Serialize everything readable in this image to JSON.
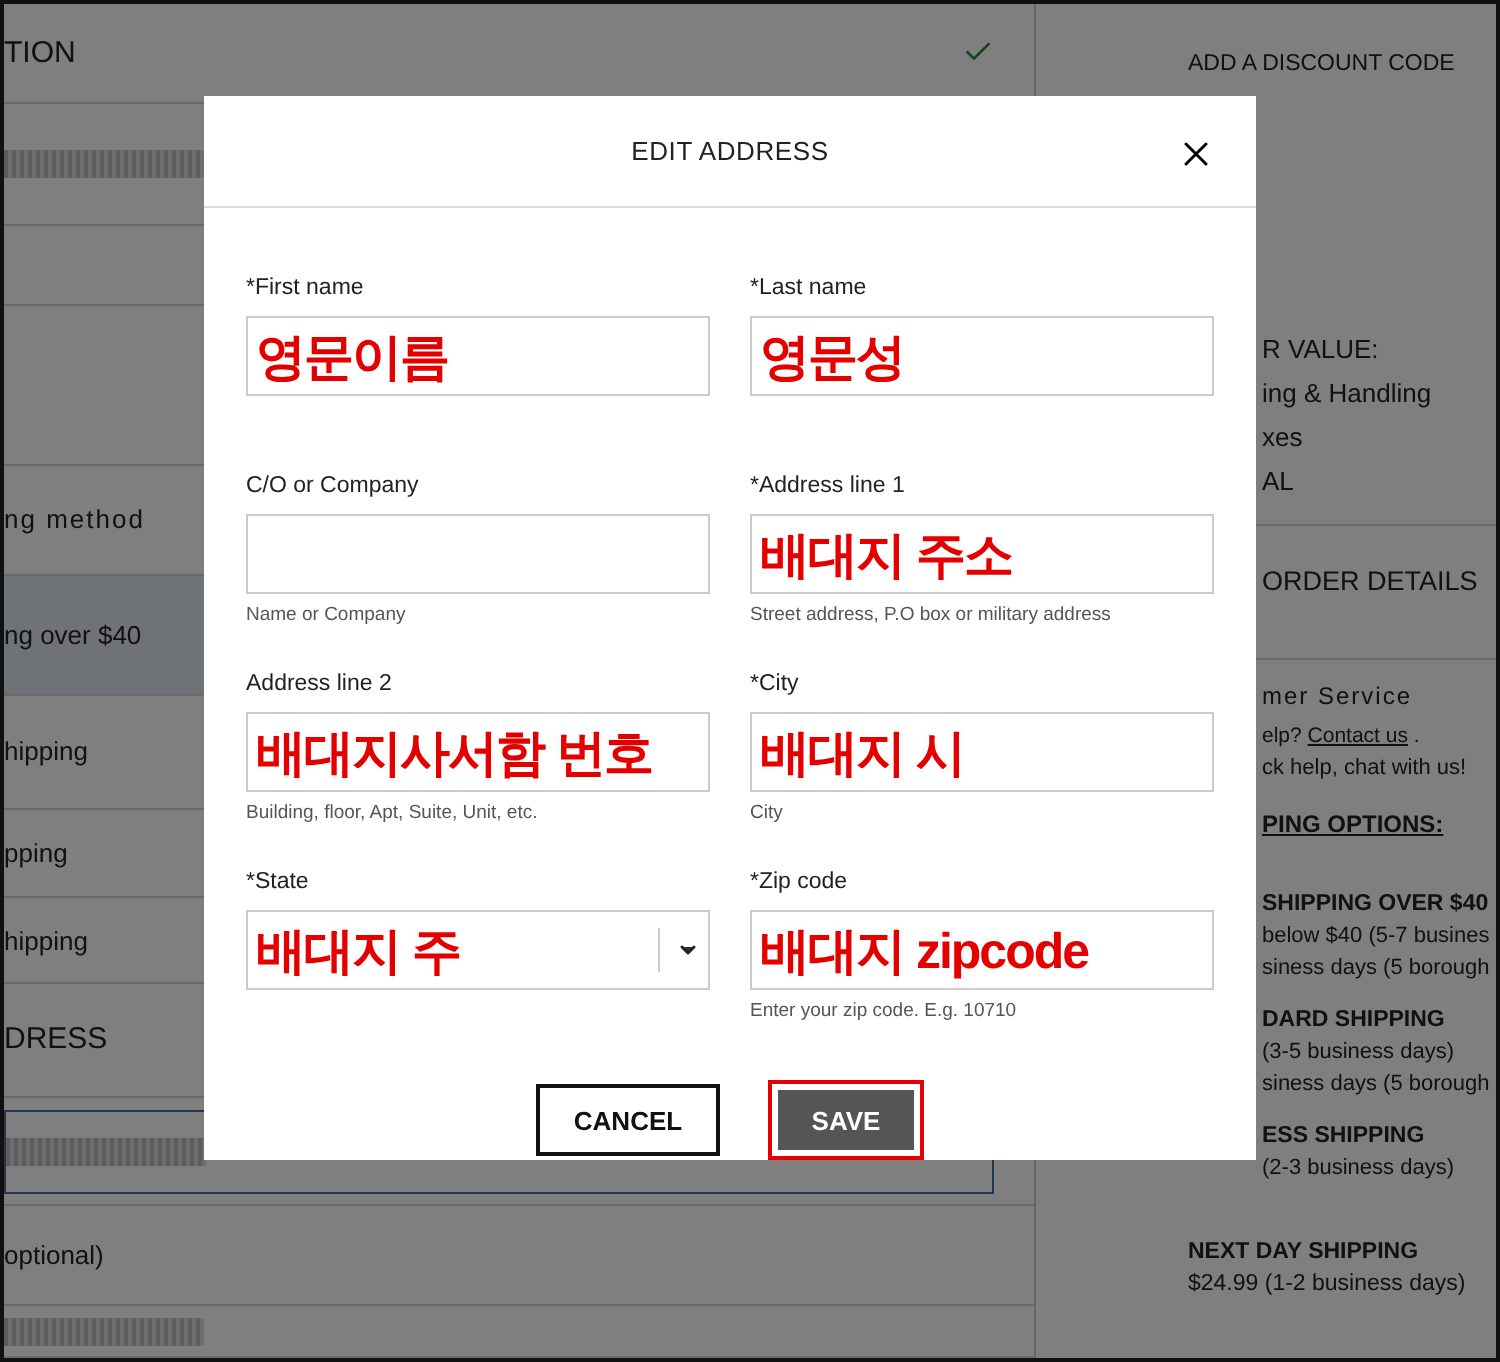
{
  "page": {
    "section_title": {
      "text": "TION",
      "completed": true
    },
    "method_heading": "ng method",
    "shipping_options": [
      {
        "label": "ng over $40",
        "selected": true
      },
      {
        "label": "hipping",
        "selected": false
      },
      {
        "label": "pping",
        "selected": false
      },
      {
        "label": "hipping",
        "selected": false
      }
    ],
    "address_title": "DRESS",
    "optional_label": "optional)"
  },
  "sidebar": [
    {
      "kind": "heading",
      "text": "ADD A DISCOUNT CODE"
    },
    {
      "kind": "gap"
    },
    {
      "kind": "cut",
      "text": "R VALUE:"
    },
    {
      "kind": "cut",
      "text": "ing & Handling"
    },
    {
      "kind": "cut",
      "text": "xes"
    },
    {
      "kind": "cut",
      "text": "AL"
    },
    {
      "kind": "rule"
    },
    {
      "kind": "cut-big",
      "text": "ORDER DETAILS"
    },
    {
      "kind": "rule"
    },
    {
      "kind": "cut-spaced",
      "text": "mer Service"
    },
    {
      "kind": "help",
      "text": "elp?",
      "link": "Contact us",
      "after": "."
    },
    {
      "kind": "cut-small",
      "text": "ck help, chat with us!"
    },
    {
      "kind": "cut-under",
      "text": "PING OPTIONS:"
    },
    {
      "kind": "cut-bold",
      "text": "SHIPPING OVER $40"
    },
    {
      "kind": "cut-small",
      "text": "below $40 (5-7 busines"
    },
    {
      "kind": "cut-small",
      "text": "siness days (5 borough"
    },
    {
      "kind": "cut-bold",
      "text": "DARD SHIPPING"
    },
    {
      "kind": "cut-small",
      "text": "(3-5 business days)"
    },
    {
      "kind": "cut-small",
      "text": "siness days (5 borough"
    },
    {
      "kind": "cut-bold",
      "text": "ESS SHIPPING"
    },
    {
      "kind": "cut-small",
      "text": "(2-3 business days)"
    },
    {
      "kind": "bold",
      "text": "NEXT DAY SHIPPING"
    },
    {
      "kind": "small",
      "text": "$24.99 (1-2 business days)"
    }
  ],
  "dialog": {
    "title": "EDIT ADDRESS",
    "fields": [
      {
        "kind": "text",
        "label": "*First name",
        "value": "영문이름"
      },
      {
        "kind": "text",
        "label": "*Last name",
        "value": "영문성"
      },
      {
        "kind": "text",
        "label": "C/O or Company",
        "hint": "Name or Company"
      },
      {
        "kind": "text",
        "label": "*Address line 1",
        "value": "배대지 주소",
        "hint": "Street address, P.O box or military address"
      },
      {
        "kind": "text",
        "label": "Address line 2",
        "value": "배대지사서함 번호",
        "hint": "Building, floor, Apt, Suite, Unit, etc."
      },
      {
        "kind": "text",
        "label": "*City",
        "value": "배대지 시",
        "hint": "City"
      },
      {
        "kind": "select",
        "label": "*State",
        "value": "배대지 주"
      },
      {
        "kind": "text",
        "label": "*Zip code",
        "value": "배대지 zipcode",
        "hint": "Enter your zip code. E.g. 10710"
      }
    ],
    "buttons": [
      {
        "kind": "secondary",
        "label": "CANCEL",
        "highlighted": false
      },
      {
        "kind": "primary",
        "label": "SAVE",
        "highlighted": true
      }
    ]
  }
}
